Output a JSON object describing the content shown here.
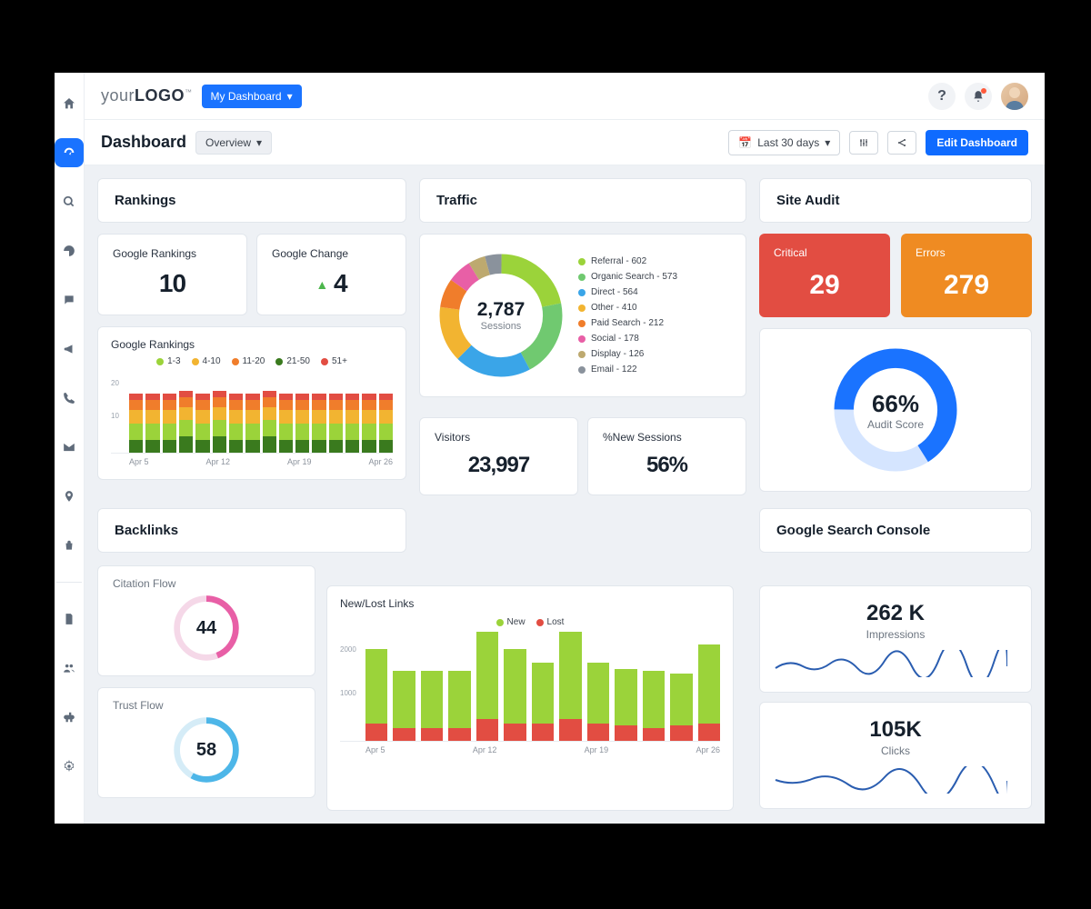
{
  "logo": {
    "part1": "your",
    "part2": "LOGO",
    "tm": "™"
  },
  "topbar": {
    "my_dashboard": "My Dashboard"
  },
  "titlebar": {
    "title": "Dashboard",
    "overview": "Overview",
    "date_label": "Last 30 days",
    "edit": "Edit Dashboard"
  },
  "sections": {
    "rankings": "Rankings",
    "traffic": "Traffic",
    "site_audit": "Site Audit",
    "backlinks": "Backlinks",
    "gsc": "Google Search Console"
  },
  "rankings": {
    "google_rankings": {
      "label": "Google Rankings",
      "value": "10"
    },
    "google_change": {
      "label": "Google Change",
      "value": "4"
    },
    "chart_title": "Google Rankings",
    "legend": [
      {
        "label": "1-3",
        "color": "#9bd33a"
      },
      {
        "label": "4-10",
        "color": "#f2b431"
      },
      {
        "label": "11-20",
        "color": "#f07d2b"
      },
      {
        "label": "21-50",
        "color": "#3a7a1e"
      },
      {
        "label": "51+",
        "color": "#e24d42"
      }
    ]
  },
  "traffic": {
    "total": "2,787",
    "total_label": "Sessions",
    "legend": [
      {
        "label": "Referral - 602",
        "color": "#9bd33a"
      },
      {
        "label": "Organic Search - 573",
        "color": "#70c970"
      },
      {
        "label": "Direct - 564",
        "color": "#3aa5e8"
      },
      {
        "label": "Other - 410",
        "color": "#f2b431"
      },
      {
        "label": "Paid Search - 212",
        "color": "#f07d2b"
      },
      {
        "label": "Social - 178",
        "color": "#e85fa6"
      },
      {
        "label": "Display - 126",
        "color": "#bda96f"
      },
      {
        "label": "Email - 122",
        "color": "#8a929c"
      }
    ],
    "visitors": {
      "label": "Visitors",
      "value": "23,997"
    },
    "new_sessions": {
      "label": "%New Sessions",
      "value": "56%"
    }
  },
  "site_audit": {
    "critical": {
      "label": "Critical",
      "value": "29"
    },
    "errors": {
      "label": "Errors",
      "value": "279"
    },
    "score": {
      "value": "66%",
      "label": "Audit Score"
    }
  },
  "backlinks": {
    "citation": {
      "label": "Citation Flow",
      "value": "44"
    },
    "trust": {
      "label": "Trust Flow",
      "value": "58"
    },
    "newlost_title": "New/Lost Links",
    "newlost_legend": [
      {
        "label": "New",
        "color": "#9bd33a"
      },
      {
        "label": "Lost",
        "color": "#e24d42"
      }
    ]
  },
  "gsc": {
    "impressions": {
      "value": "262 K",
      "label": "Impressions"
    },
    "clicks": {
      "value": "105K",
      "label": "Clicks"
    }
  },
  "chart_data": [
    {
      "type": "bar",
      "title": "Google Rankings",
      "categories": [
        "Apr 5",
        "Apr 12",
        "Apr 19",
        "Apr 26"
      ],
      "yticks": [
        10,
        20
      ],
      "series": [
        {
          "name": "51+",
          "color": "#e24d42",
          "values": [
            2,
            2,
            2,
            2,
            2,
            2,
            2,
            2,
            2,
            2,
            2,
            2,
            2,
            2,
            2,
            2
          ]
        },
        {
          "name": "21-50",
          "color": "#f07d2b",
          "values": [
            3,
            3,
            3,
            3,
            3,
            3,
            3,
            3,
            3,
            3,
            3,
            3,
            3,
            3,
            3,
            3
          ]
        },
        {
          "name": "11-20",
          "color": "#f2b431",
          "values": [
            4,
            4,
            4,
            4,
            4,
            4,
            4,
            4,
            4,
            4,
            4,
            4,
            4,
            4,
            4,
            4
          ]
        },
        {
          "name": "4-10",
          "color": "#9bd33a",
          "values": [
            5,
            5,
            5,
            5,
            5,
            5,
            5,
            5,
            5,
            5,
            5,
            5,
            5,
            5,
            5,
            5
          ]
        },
        {
          "name": "1-3",
          "color": "#3a7a1e",
          "values": [
            4,
            4,
            4,
            5,
            4,
            5,
            4,
            4,
            5,
            4,
            4,
            4,
            4,
            4,
            4,
            4
          ]
        }
      ]
    },
    {
      "type": "pie",
      "title": "Traffic Sessions",
      "total": 2787,
      "slices": [
        {
          "name": "Referral",
          "value": 602,
          "color": "#9bd33a"
        },
        {
          "name": "Organic Search",
          "value": 573,
          "color": "#70c970"
        },
        {
          "name": "Direct",
          "value": 564,
          "color": "#3aa5e8"
        },
        {
          "name": "Other",
          "value": 410,
          "color": "#f2b431"
        },
        {
          "name": "Paid Search",
          "value": 212,
          "color": "#f07d2b"
        },
        {
          "name": "Social",
          "value": 178,
          "color": "#e85fa6"
        },
        {
          "name": "Display",
          "value": 126,
          "color": "#bda96f"
        },
        {
          "name": "Email",
          "value": 122,
          "color": "#8a929c"
        }
      ]
    },
    {
      "type": "pie",
      "title": "Audit Score",
      "slices": [
        {
          "name": "score",
          "value": 66,
          "color": "#1a73ff"
        },
        {
          "name": "remaining",
          "value": 34,
          "color": "#d5e5ff"
        }
      ]
    },
    {
      "type": "pie",
      "title": "Citation Flow",
      "slices": [
        {
          "name": "value",
          "value": 44,
          "color": "#e85fa6"
        },
        {
          "name": "remaining",
          "value": 56,
          "color": "#f5d8e8"
        }
      ]
    },
    {
      "type": "pie",
      "title": "Trust Flow",
      "slices": [
        {
          "name": "value",
          "value": 58,
          "color": "#4db6e8"
        },
        {
          "name": "remaining",
          "value": 42,
          "color": "#d5ecf7"
        }
      ]
    },
    {
      "type": "bar",
      "title": "New/Lost Links",
      "categories": [
        "Apr 5",
        "Apr 12",
        "Apr 19",
        "Apr 26"
      ],
      "yticks": [
        1000,
        2000
      ],
      "series": [
        {
          "name": "New",
          "color": "#9bd33a",
          "values": [
            1700,
            1300,
            1300,
            1300,
            2000,
            1700,
            1400,
            2000,
            1400,
            1300,
            1300,
            1200,
            1800
          ]
        },
        {
          "name": "Lost",
          "color": "#e24d42",
          "values": [
            400,
            300,
            300,
            300,
            500,
            400,
            400,
            500,
            400,
            350,
            300,
            350,
            400
          ]
        }
      ]
    }
  ]
}
